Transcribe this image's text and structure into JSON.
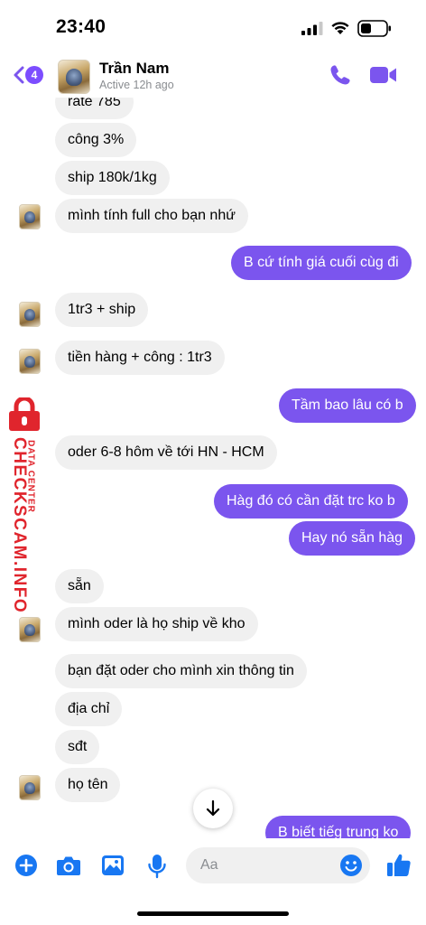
{
  "status_bar": {
    "time": "23:40"
  },
  "header": {
    "unread_count": "4",
    "contact_name": "Trần Nam",
    "contact_status": "Active 12h ago"
  },
  "messages": [
    {
      "side": "in",
      "text": "rate 785"
    },
    {
      "side": "in",
      "text": "công 3%"
    },
    {
      "side": "in",
      "text": "ship 180k/1kg"
    },
    {
      "side": "in",
      "text": "mình tính full cho bạn nhứ"
    },
    {
      "side": "out",
      "text": "B cứ tính giá cuối cùg đi"
    },
    {
      "side": "in",
      "text": "1tr3 + ship"
    },
    {
      "side": "in",
      "text": "tiền hàng + công : 1tr3"
    },
    {
      "side": "out",
      "text": "Tầm bao lâu có b"
    },
    {
      "side": "in",
      "text": "oder 6-8 hôm về tới HN - HCM"
    },
    {
      "side": "out",
      "text": "Hàg đó có cần đặt trc ko b"
    },
    {
      "side": "out",
      "text": "Hay nó sẵn hàg"
    },
    {
      "side": "in",
      "text": "sẵn"
    },
    {
      "side": "in",
      "text": "mình oder là họ ship về kho"
    },
    {
      "side": "in",
      "text": "bạn đặt oder cho mình xin thông tin"
    },
    {
      "side": "in",
      "text": "địa chỉ"
    },
    {
      "side": "in",
      "text": "sđt"
    },
    {
      "side": "in",
      "text": "họ tên"
    },
    {
      "side": "out",
      "text": "B biết tiếg trung ko"
    }
  ],
  "watermark": {
    "main": "CHECKSCAM.INFO",
    "sub": "DATA CENTER"
  },
  "composer": {
    "placeholder": "Aa"
  },
  "colors": {
    "accent": "#7b55ee",
    "incoming_bubble": "#f0f0f0",
    "watermark": "#e0252d"
  }
}
